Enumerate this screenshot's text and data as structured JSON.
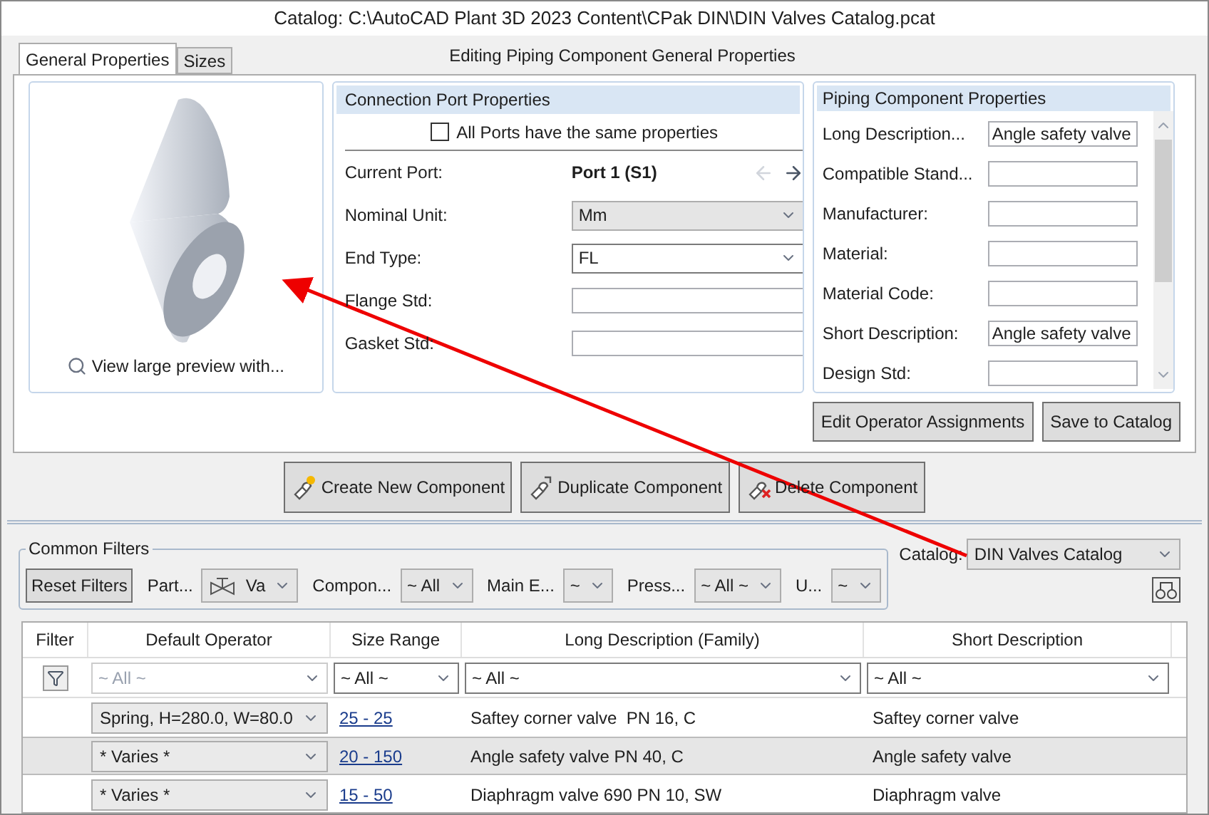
{
  "window": {
    "title": "Catalog: C:\\AutoCAD Plant 3D 2023 Content\\CPak DIN\\DIN Valves Catalog.pcat"
  },
  "tabs": [
    {
      "label": "General Properties",
      "selected": true
    },
    {
      "label": "Sizes",
      "selected": false
    }
  ],
  "header": "Editing Piping Component General Properties",
  "preview": {
    "link": "View large preview with..."
  },
  "connection_port": {
    "title": "Connection Port Properties",
    "same_properties": {
      "label": "All Ports have the same properties",
      "checked": false
    },
    "fields": [
      {
        "kind": "port",
        "label": "Current Port:",
        "value": "Port 1 (S1)"
      },
      {
        "kind": "select",
        "label": "Nominal Unit:",
        "value": "Mm",
        "disabled": true
      },
      {
        "kind": "select",
        "label": "End Type:",
        "value": "FL",
        "disabled": false
      },
      {
        "kind": "text",
        "label": "Flange Std:"
      },
      {
        "kind": "text",
        "label": "Gasket Std:"
      }
    ]
  },
  "component_properties": {
    "title": "Piping Component Properties",
    "fields": [
      {
        "label": "Long Description...",
        "value": "Angle safety valve"
      },
      {
        "label": "Compatible Stand..."
      },
      {
        "label": "Manufacturer:"
      },
      {
        "label": "Material:"
      },
      {
        "label": "Material Code:"
      },
      {
        "label": "Short Description:",
        "value": "Angle safety valve"
      },
      {
        "label": "Design Std:"
      }
    ]
  },
  "property_buttons": [
    "Edit Operator Assignments",
    "Save to Catalog"
  ],
  "actions": [
    {
      "kind": "create",
      "label": "Create New Component"
    },
    {
      "kind": "duplicate",
      "label": "Duplicate Component"
    },
    {
      "kind": "delete",
      "label": "Delete Component"
    }
  ],
  "filters": {
    "legend": "Common Filters",
    "reset": "Reset Filters",
    "items": [
      {
        "label": "Part...",
        "value": "Va",
        "kind": "valve"
      },
      {
        "label": "Compon...",
        "value": "~ All",
        "kind": "plain"
      },
      {
        "label": "Main E...",
        "value": "~",
        "kind": "plain"
      },
      {
        "label": "Press...",
        "value": "~ All ~",
        "kind": "plain"
      },
      {
        "label": "U...",
        "value": "~",
        "kind": "plain"
      }
    ],
    "catalog_label": "Catalog:",
    "catalog_value": "DIN Valves Catalog"
  },
  "table": {
    "columns": [
      "Filter",
      "Default Operator",
      "Size Range",
      "Long Description (Family)",
      "Short Description"
    ],
    "filter_row": [
      {
        "value": "~ All ~",
        "disabled": true
      },
      {
        "value": "~ All ~",
        "disabled": false
      },
      {
        "value": "~ All ~",
        "disabled": false
      },
      {
        "value": "~ All ~",
        "disabled": false
      }
    ],
    "rows": [
      {
        "operator": "Spring, H=280.0, W=80.0",
        "size_range": "25 - 25",
        "long_description": "Saftey corner valve  PN 16, C",
        "short_description": "Saftey corner valve",
        "selected": false
      },
      {
        "operator": "* Varies *",
        "size_range": "20 - 150",
        "long_description": "Angle safety valve PN 40, C",
        "short_description": "Angle safety valve",
        "selected": true
      },
      {
        "operator": "* Varies *",
        "size_range": "15 - 50",
        "long_description": "Diaphragm valve 690 PN 10, SW",
        "short_description": "Diaphragm valve",
        "selected": false
      }
    ]
  }
}
